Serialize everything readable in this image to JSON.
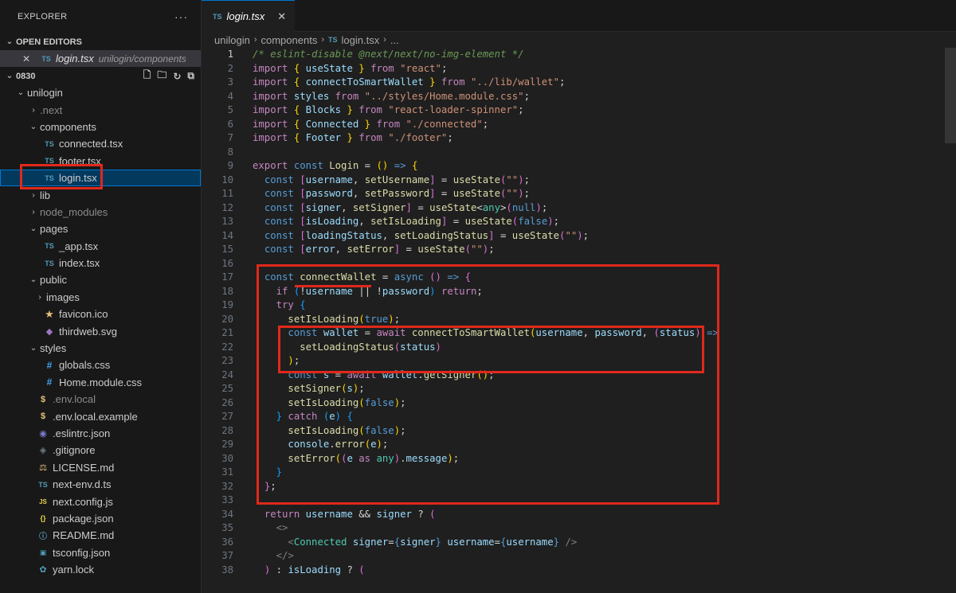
{
  "explorer": {
    "title": "EXPLORER",
    "more": "···",
    "open_editors_label": "OPEN EDITORS",
    "open_editor": {
      "name": "login.tsx",
      "path": "unilogin/components",
      "icon": "TS"
    },
    "workspace_label": "0830",
    "tree": [
      {
        "label": "unilogin",
        "type": "folder",
        "open": true,
        "depth": 1
      },
      {
        "label": ".next",
        "type": "folder",
        "open": false,
        "depth": 2,
        "dim": true
      },
      {
        "label": "components",
        "type": "folder",
        "open": true,
        "depth": 2
      },
      {
        "label": "connected.tsx",
        "type": "ts",
        "depth": 3
      },
      {
        "label": "footer.tsx",
        "type": "ts",
        "depth": 3
      },
      {
        "label": "login.tsx",
        "type": "ts",
        "depth": 3,
        "active": true
      },
      {
        "label": "lib",
        "type": "folder",
        "open": false,
        "depth": 2
      },
      {
        "label": "node_modules",
        "type": "folder",
        "open": false,
        "depth": 2,
        "dim": true
      },
      {
        "label": "pages",
        "type": "folder",
        "open": true,
        "depth": 2
      },
      {
        "label": "_app.tsx",
        "type": "ts",
        "depth": 3
      },
      {
        "label": "index.tsx",
        "type": "ts",
        "depth": 3
      },
      {
        "label": "public",
        "type": "folder",
        "open": true,
        "depth": 2
      },
      {
        "label": "images",
        "type": "folder",
        "open": false,
        "depth": 3
      },
      {
        "label": "favicon.ico",
        "type": "star",
        "depth": 3
      },
      {
        "label": "thirdweb.svg",
        "type": "svg",
        "depth": 3
      },
      {
        "label": "styles",
        "type": "folder",
        "open": true,
        "depth": 2
      },
      {
        "label": "globals.css",
        "type": "css",
        "depth": 3
      },
      {
        "label": "Home.module.css",
        "type": "css",
        "depth": 3
      },
      {
        "label": ".env.local",
        "type": "env",
        "depth": 2,
        "dim": true
      },
      {
        "label": ".env.local.example",
        "type": "env",
        "depth": 2
      },
      {
        "label": ".eslintrc.json",
        "type": "eslint",
        "depth": 2
      },
      {
        "label": ".gitignore",
        "type": "git",
        "depth": 2
      },
      {
        "label": "LICENSE.md",
        "type": "license",
        "depth": 2
      },
      {
        "label": "next-env.d.ts",
        "type": "ts",
        "depth": 2
      },
      {
        "label": "next.config.js",
        "type": "js",
        "depth": 2
      },
      {
        "label": "package.json",
        "type": "json",
        "depth": 2
      },
      {
        "label": "README.md",
        "type": "md",
        "depth": 2
      },
      {
        "label": "tsconfig.json",
        "type": "tsconfig",
        "depth": 2
      },
      {
        "label": "yarn.lock",
        "type": "yarn",
        "depth": 2
      }
    ]
  },
  "editor": {
    "tab": {
      "name": "login.tsx",
      "icon": "TS",
      "close": "✕"
    },
    "breadcrumb": [
      "unilogin",
      "components",
      "login.tsx",
      "..."
    ],
    "current_line": 1,
    "lines": [
      [
        [
          "cm",
          "/* eslint-disable @next/next/no-img-element */"
        ]
      ],
      [
        [
          "kw",
          "import"
        ],
        [
          "op",
          " "
        ],
        [
          "br1",
          "{"
        ],
        [
          "var",
          " useState "
        ],
        [
          "br1",
          "}"
        ],
        [
          "kw",
          " from "
        ],
        [
          "str",
          "\"react\""
        ],
        [
          "op",
          ";"
        ]
      ],
      [
        [
          "kw",
          "import"
        ],
        [
          "op",
          " "
        ],
        [
          "br1",
          "{"
        ],
        [
          "var",
          " connectToSmartWallet "
        ],
        [
          "br1",
          "}"
        ],
        [
          "kw",
          " from "
        ],
        [
          "str",
          "\"../lib/wallet\""
        ],
        [
          "op",
          ";"
        ]
      ],
      [
        [
          "kw",
          "import"
        ],
        [
          "var",
          " styles"
        ],
        [
          "kw",
          " from "
        ],
        [
          "str",
          "\"../styles/Home.module.css\""
        ],
        [
          "op",
          ";"
        ]
      ],
      [
        [
          "kw",
          "import"
        ],
        [
          "op",
          " "
        ],
        [
          "br1",
          "{"
        ],
        [
          "var",
          " Blocks "
        ],
        [
          "br1",
          "}"
        ],
        [
          "kw",
          " from "
        ],
        [
          "str",
          "\"react-loader-spinner\""
        ],
        [
          "op",
          ";"
        ]
      ],
      [
        [
          "kw",
          "import"
        ],
        [
          "op",
          " "
        ],
        [
          "br1",
          "{"
        ],
        [
          "var",
          " Connected "
        ],
        [
          "br1",
          "}"
        ],
        [
          "kw",
          " from "
        ],
        [
          "str",
          "\"./connected\""
        ],
        [
          "op",
          ";"
        ]
      ],
      [
        [
          "kw",
          "import"
        ],
        [
          "op",
          " "
        ],
        [
          "br1",
          "{"
        ],
        [
          "var",
          " Footer "
        ],
        [
          "br1",
          "}"
        ],
        [
          "kw",
          " from "
        ],
        [
          "str",
          "\"./footer\""
        ],
        [
          "op",
          ";"
        ]
      ],
      [],
      [
        [
          "kw",
          "export"
        ],
        [
          "dec",
          " const "
        ],
        [
          "fn",
          "Login"
        ],
        [
          "op",
          " = "
        ],
        [
          "br1",
          "()"
        ],
        [
          "dec",
          " => "
        ],
        [
          "br1",
          "{"
        ]
      ],
      [
        [
          "op",
          "  "
        ],
        [
          "dec",
          "const "
        ],
        [
          "br2",
          "["
        ],
        [
          "var",
          "username"
        ],
        [
          "op",
          ", "
        ],
        [
          "fn",
          "setUsername"
        ],
        [
          "br2",
          "]"
        ],
        [
          "op",
          " = "
        ],
        [
          "fn",
          "useState"
        ],
        [
          "br2",
          "("
        ],
        [
          "str",
          "\"\""
        ],
        [
          "br2",
          ")"
        ],
        [
          "op",
          ";"
        ]
      ],
      [
        [
          "op",
          "  "
        ],
        [
          "dec",
          "const "
        ],
        [
          "br2",
          "["
        ],
        [
          "var",
          "password"
        ],
        [
          "op",
          ", "
        ],
        [
          "fn",
          "setPassword"
        ],
        [
          "br2",
          "]"
        ],
        [
          "op",
          " = "
        ],
        [
          "fn",
          "useState"
        ],
        [
          "br2",
          "("
        ],
        [
          "str",
          "\"\""
        ],
        [
          "br2",
          ")"
        ],
        [
          "op",
          ";"
        ]
      ],
      [
        [
          "op",
          "  "
        ],
        [
          "dec",
          "const "
        ],
        [
          "br2",
          "["
        ],
        [
          "var",
          "signer"
        ],
        [
          "op",
          ", "
        ],
        [
          "fn",
          "setSigner"
        ],
        [
          "br2",
          "]"
        ],
        [
          "op",
          " = "
        ],
        [
          "fn",
          "useState"
        ],
        [
          "op",
          "<"
        ],
        [
          "ty",
          "any"
        ],
        [
          "op",
          ">"
        ],
        [
          "br2",
          "("
        ],
        [
          "cst",
          "null"
        ],
        [
          "br2",
          ")"
        ],
        [
          "op",
          ";"
        ]
      ],
      [
        [
          "op",
          "  "
        ],
        [
          "dec",
          "const "
        ],
        [
          "br2",
          "["
        ],
        [
          "var",
          "isLoading"
        ],
        [
          "op",
          ", "
        ],
        [
          "fn",
          "setIsLoading"
        ],
        [
          "br2",
          "]"
        ],
        [
          "op",
          " = "
        ],
        [
          "fn",
          "useState"
        ],
        [
          "br2",
          "("
        ],
        [
          "cst",
          "false"
        ],
        [
          "br2",
          ")"
        ],
        [
          "op",
          ";"
        ]
      ],
      [
        [
          "op",
          "  "
        ],
        [
          "dec",
          "const "
        ],
        [
          "br2",
          "["
        ],
        [
          "var",
          "loadingStatus"
        ],
        [
          "op",
          ", "
        ],
        [
          "fn",
          "setLoadingStatus"
        ],
        [
          "br2",
          "]"
        ],
        [
          "op",
          " = "
        ],
        [
          "fn",
          "useState"
        ],
        [
          "br2",
          "("
        ],
        [
          "str",
          "\"\""
        ],
        [
          "br2",
          ")"
        ],
        [
          "op",
          ";"
        ]
      ],
      [
        [
          "op",
          "  "
        ],
        [
          "dec",
          "const "
        ],
        [
          "br2",
          "["
        ],
        [
          "var",
          "error"
        ],
        [
          "op",
          ", "
        ],
        [
          "fn",
          "setError"
        ],
        [
          "br2",
          "]"
        ],
        [
          "op",
          " = "
        ],
        [
          "fn",
          "useState"
        ],
        [
          "br2",
          "("
        ],
        [
          "str",
          "\"\""
        ],
        [
          "br2",
          ")"
        ],
        [
          "op",
          ";"
        ]
      ],
      [],
      [
        [
          "op",
          "  "
        ],
        [
          "dec",
          "const "
        ],
        [
          "fn",
          "connectWallet"
        ],
        [
          "op",
          " = "
        ],
        [
          "dec",
          "async "
        ],
        [
          "br2",
          "()"
        ],
        [
          "dec",
          " => "
        ],
        [
          "br2",
          "{"
        ]
      ],
      [
        [
          "op",
          "    "
        ],
        [
          "kw",
          "if "
        ],
        [
          "br3",
          "("
        ],
        [
          "op",
          "!"
        ],
        [
          "var",
          "username"
        ],
        [
          "op",
          " || !"
        ],
        [
          "var",
          "password"
        ],
        [
          "br3",
          ")"
        ],
        [
          "kw",
          " return"
        ],
        [
          "op",
          ";"
        ]
      ],
      [
        [
          "op",
          "    "
        ],
        [
          "kw",
          "try "
        ],
        [
          "br3",
          "{"
        ]
      ],
      [
        [
          "op",
          "      "
        ],
        [
          "fn",
          "setIsLoading"
        ],
        [
          "br1",
          "("
        ],
        [
          "cst",
          "true"
        ],
        [
          "br1",
          ")"
        ],
        [
          "op",
          ";"
        ]
      ],
      [
        [
          "op",
          "      "
        ],
        [
          "dec",
          "const "
        ],
        [
          "var",
          "wallet"
        ],
        [
          "op",
          " = "
        ],
        [
          "kw",
          "await "
        ],
        [
          "fn",
          "connectToSmartWallet"
        ],
        [
          "br1",
          "("
        ],
        [
          "var",
          "username"
        ],
        [
          "op",
          ", "
        ],
        [
          "var",
          "password"
        ],
        [
          "op",
          ", "
        ],
        [
          "br2",
          "("
        ],
        [
          "var",
          "status"
        ],
        [
          "br2",
          ")"
        ],
        [
          "dec",
          " =>"
        ]
      ],
      [
        [
          "op",
          "        "
        ],
        [
          "fn",
          "setLoadingStatus"
        ],
        [
          "br2",
          "("
        ],
        [
          "var",
          "status"
        ],
        [
          "br2",
          ")"
        ]
      ],
      [
        [
          "op",
          "      "
        ],
        [
          "br1",
          ")"
        ],
        [
          "op",
          ";"
        ]
      ],
      [
        [
          "op",
          "      "
        ],
        [
          "dec",
          "const "
        ],
        [
          "var",
          "s"
        ],
        [
          "op",
          " = "
        ],
        [
          "kw",
          "await "
        ],
        [
          "var",
          "wallet"
        ],
        [
          "op",
          "."
        ],
        [
          "fn",
          "getSigner"
        ],
        [
          "br1",
          "()"
        ],
        [
          "op",
          ";"
        ]
      ],
      [
        [
          "op",
          "      "
        ],
        [
          "fn",
          "setSigner"
        ],
        [
          "br1",
          "("
        ],
        [
          "var",
          "s"
        ],
        [
          "br1",
          ")"
        ],
        [
          "op",
          ";"
        ]
      ],
      [
        [
          "op",
          "      "
        ],
        [
          "fn",
          "setIsLoading"
        ],
        [
          "br1",
          "("
        ],
        [
          "cst",
          "false"
        ],
        [
          "br1",
          ")"
        ],
        [
          "op",
          ";"
        ]
      ],
      [
        [
          "op",
          "    "
        ],
        [
          "br3",
          "}"
        ],
        [
          "kw",
          " catch "
        ],
        [
          "br3",
          "("
        ],
        [
          "var",
          "e"
        ],
        [
          "br3",
          ")"
        ],
        [
          "op",
          " "
        ],
        [
          "br3",
          "{"
        ]
      ],
      [
        [
          "op",
          "      "
        ],
        [
          "fn",
          "setIsLoading"
        ],
        [
          "br1",
          "("
        ],
        [
          "cst",
          "false"
        ],
        [
          "br1",
          ")"
        ],
        [
          "op",
          ";"
        ]
      ],
      [
        [
          "op",
          "      "
        ],
        [
          "var",
          "console"
        ],
        [
          "op",
          "."
        ],
        [
          "fn",
          "error"
        ],
        [
          "br1",
          "("
        ],
        [
          "var",
          "e"
        ],
        [
          "br1",
          ")"
        ],
        [
          "op",
          ";"
        ]
      ],
      [
        [
          "op",
          "      "
        ],
        [
          "fn",
          "setError"
        ],
        [
          "br1",
          "("
        ],
        [
          "br2",
          "("
        ],
        [
          "var",
          "e"
        ],
        [
          "kw",
          " as "
        ],
        [
          "ty",
          "any"
        ],
        [
          "br2",
          ")"
        ],
        [
          "op",
          "."
        ],
        [
          "var",
          "message"
        ],
        [
          "br1",
          ")"
        ],
        [
          "op",
          ";"
        ]
      ],
      [
        [
          "op",
          "    "
        ],
        [
          "br3",
          "}"
        ]
      ],
      [
        [
          "op",
          "  "
        ],
        [
          "br2",
          "}"
        ],
        [
          "op",
          ";"
        ]
      ],
      [],
      [
        [
          "op",
          "  "
        ],
        [
          "kw",
          "return "
        ],
        [
          "var",
          "username"
        ],
        [
          "op",
          " && "
        ],
        [
          "var",
          "signer"
        ],
        [
          "op",
          " ? "
        ],
        [
          "br2",
          "("
        ]
      ],
      [
        [
          "op",
          "    "
        ],
        [
          "tag",
          "<>"
        ]
      ],
      [
        [
          "op",
          "      "
        ],
        [
          "tag",
          "<"
        ],
        [
          "tname",
          "Connected"
        ],
        [
          "attr",
          " signer"
        ],
        [
          "op",
          "="
        ],
        [
          "dec",
          "{"
        ],
        [
          "var",
          "signer"
        ],
        [
          "dec",
          "}"
        ],
        [
          "attr",
          " username"
        ],
        [
          "op",
          "="
        ],
        [
          "dec",
          "{"
        ],
        [
          "var",
          "username"
        ],
        [
          "dec",
          "}"
        ],
        [
          "tag",
          " />"
        ]
      ],
      [
        [
          "op",
          "    "
        ],
        [
          "tag",
          "</>"
        ]
      ],
      [
        [
          "op",
          "  "
        ],
        [
          "br2",
          ")"
        ],
        [
          "op",
          " : "
        ],
        [
          "var",
          "isLoading"
        ],
        [
          "op",
          " ? "
        ],
        [
          "br2",
          "("
        ]
      ]
    ]
  }
}
